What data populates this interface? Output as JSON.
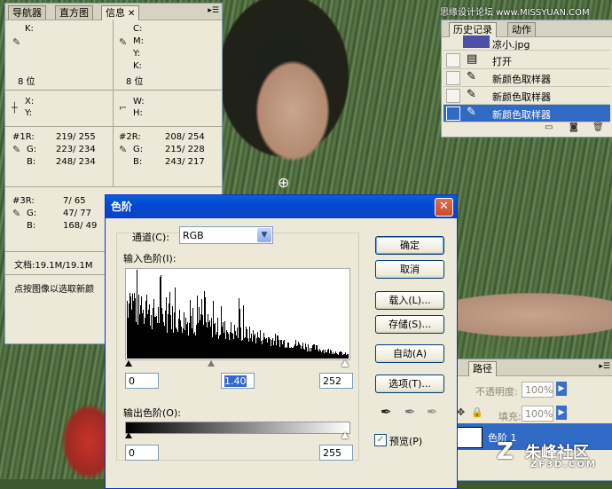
{
  "info_panel": {
    "tabs": [
      "导航器",
      "直方图",
      "信息"
    ],
    "k": "K:",
    "c": "C:",
    "m": "M:",
    "y": "Y:",
    "k2": "K:",
    "bits_left": "8 位",
    "bits_right": "8 位",
    "x": "X:",
    "y_coord": "Y:",
    "w": "W:",
    "h": "H:",
    "s1": {
      "r": "#1R:",
      "g": "G:",
      "b": "B:",
      "rv": "219/ 255",
      "gv": "223/ 234",
      "bv": "248/ 234"
    },
    "s2": {
      "r": "#2R:",
      "g": "G:",
      "b": "B:",
      "rv": "208/ 254",
      "gv": "215/ 228",
      "bv": "243/ 217"
    },
    "s3": {
      "r": "#3R:",
      "g": "G:",
      "b": "B:",
      "rv": "7/ 65",
      "gv": "47/ 77",
      "bv": "168/ 49"
    },
    "doc": "文档:19.1M/19.1M",
    "hint": "点按图像以选取新颜"
  },
  "history_panel": {
    "tabs": [
      "历史记录",
      "动作"
    ],
    "snapshot": "凉小.jpg",
    "items": [
      "打开",
      "新颜色取样器",
      "新颜色取样器",
      "新颜色取样器"
    ]
  },
  "watermark_top": "思缘设计论坛 www.MISSYUAN.COM",
  "levels_dialog": {
    "title": "色阶",
    "channel_label": "通道(C):",
    "channel_value": "RGB",
    "input_label": "输入色阶(I):",
    "input_black": "0",
    "input_gamma": "1.40",
    "input_white": "252",
    "output_label": "输出色阶(O):",
    "output_black": "0",
    "output_white": "255",
    "buttons": {
      "ok": "确定",
      "cancel": "取消",
      "load": "载入(L)...",
      "save": "存储(S)...",
      "auto": "自动(A)",
      "options": "选项(T)..."
    },
    "preview_label": "预览(P)",
    "preview_checked": true
  },
  "layers_panel": {
    "tab_paths": "路径",
    "opacity_label": "不透明度:",
    "opacity_value": "100%",
    "fill_label": "填充:",
    "fill_value": "100%",
    "layer_name": "色阶 1"
  },
  "watermark_bottom": {
    "brand": "朱峰社区",
    "url": "ZF3D.COM"
  }
}
